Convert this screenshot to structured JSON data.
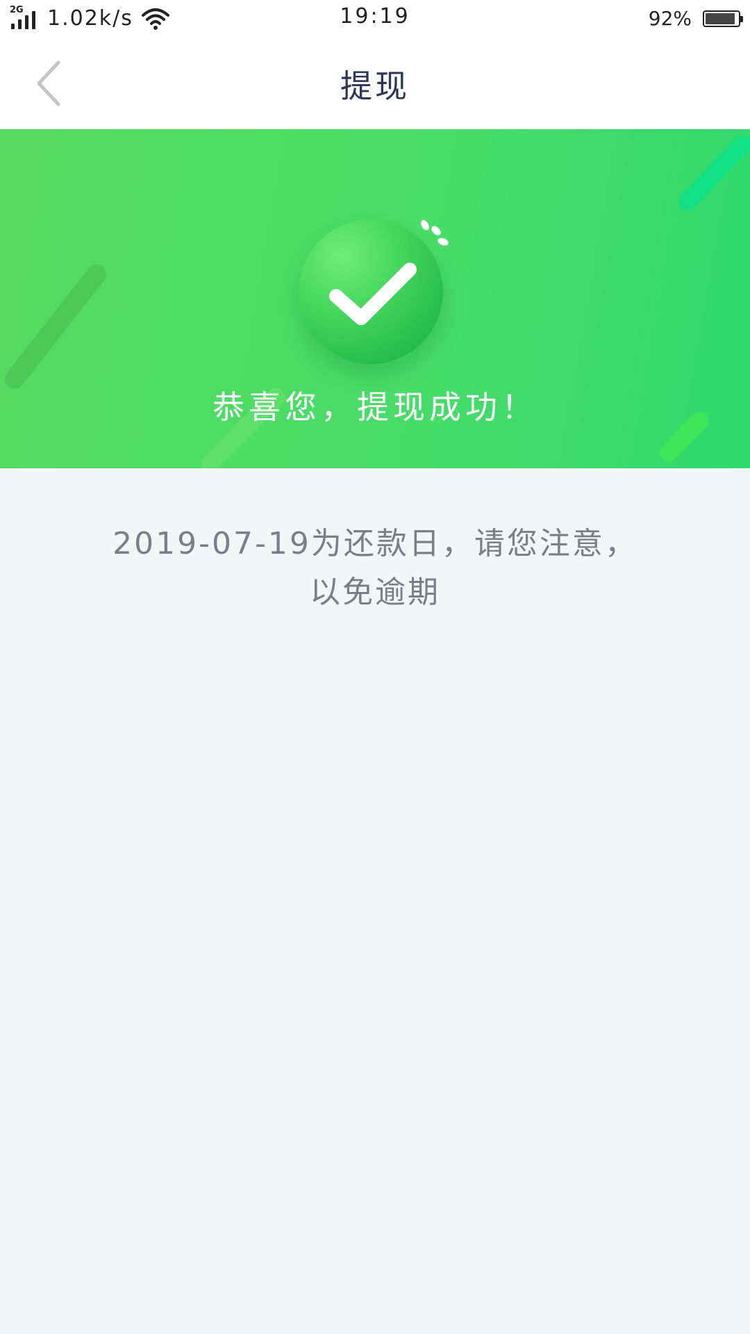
{
  "status_bar": {
    "network_type": "2G",
    "network_speed": "1.02k/s",
    "time": "19:19",
    "battery_percent": "92%",
    "battery_level": 0.92,
    "icons": [
      "signal-icon",
      "wifi-icon",
      "battery-icon"
    ]
  },
  "nav": {
    "title": "提现",
    "back_icon": "chevron-left-icon"
  },
  "hero": {
    "message": "恭喜您，提现成功！",
    "icon": "check-icon",
    "colors": {
      "gradient_start": "#55db5e",
      "gradient_end": "#2ed96c",
      "badge": "#3fd25a"
    }
  },
  "notice": {
    "line1": "2019-07-19为还款日，请您注意，",
    "line2": "以免逾期"
  }
}
